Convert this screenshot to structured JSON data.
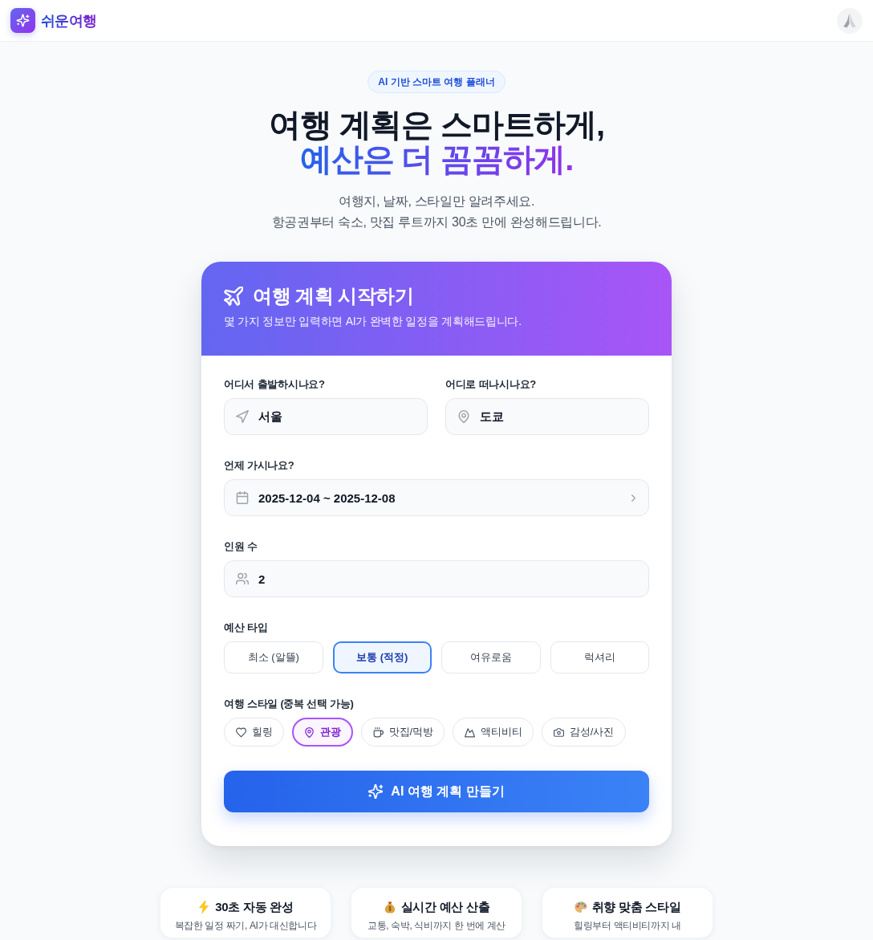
{
  "header": {
    "brand": "쉬운여행"
  },
  "hero": {
    "badge": "AI 기반 스마트 여행 플래너",
    "title_line_1": "여행 계획은 스마트하게,",
    "title_line_2": "예산은 더 꼼꼼하게.",
    "subtitle_lines": [
      "여행지, 날짜, 스타일만 알려주세요.",
      "항공권부터 숙소, 맛집 루트까지 30초 만에 완성해드립니다."
    ]
  },
  "planner": {
    "title": "여행 계획 시작하기",
    "subtitle": "몇 가지 정보만 입력하면 AI가 완벽한 일정을 계획해드립니다.",
    "origin": {
      "label": "어디서 출발하시나요?",
      "value": "서울"
    },
    "destination": {
      "label": "어디로 떠나시나요?",
      "value": "도쿄"
    },
    "dates": {
      "label": "언제 가시나요?",
      "value": "2025-12-04 ~ 2025-12-08"
    },
    "travelers": {
      "label": "인원 수",
      "value": "2"
    },
    "budget": {
      "label": "예산 타입",
      "options": [
        {
          "label": "최소 (알뜰)",
          "selected": false
        },
        {
          "label": "보통 (적정)",
          "selected": true
        },
        {
          "label": "여유로움",
          "selected": false
        },
        {
          "label": "럭셔리",
          "selected": false
        }
      ]
    },
    "styles": {
      "label": "여행 스타일 (중복 선택 가능)",
      "options": [
        {
          "label": "힐링",
          "selected": false
        },
        {
          "label": "관광",
          "selected": true
        },
        {
          "label": "맛집/먹방",
          "selected": false
        },
        {
          "label": "액티비티",
          "selected": false
        },
        {
          "label": "감성/사진",
          "selected": false
        }
      ]
    },
    "submit": "AI 여행 계획 만들기"
  },
  "features": [
    {
      "title": "30초 자동 완성",
      "description": "복잡한 일정 짜기, AI가 대신합니다"
    },
    {
      "title": "실시간 예산 산출",
      "description": "교통, 숙박, 식비까지 한 번에 계산"
    },
    {
      "title": "취향 맞춤 스타일",
      "description": "힐링부터 액티비티까지 내"
    }
  ]
}
